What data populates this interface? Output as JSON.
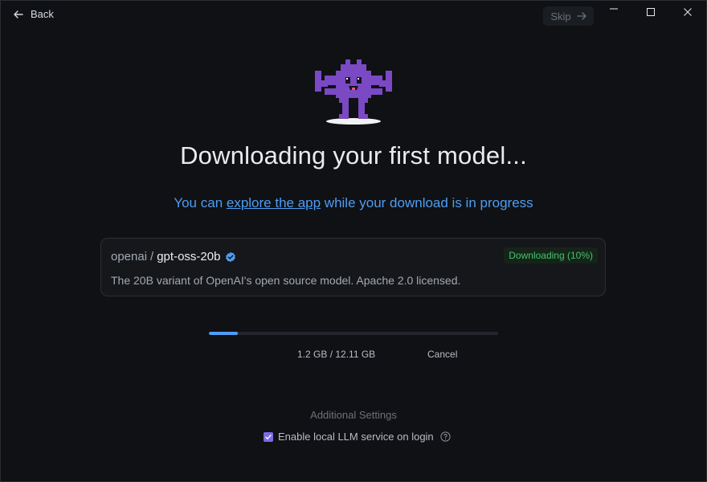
{
  "topbar": {
    "back_label": "Back",
    "skip_label": "Skip"
  },
  "main": {
    "title": "Downloading your first model...",
    "subtitle_prefix": "You can ",
    "subtitle_link": "explore the app",
    "subtitle_suffix": " while your download is in progress"
  },
  "model": {
    "org": "openai",
    "separator": "/",
    "name": "gpt-oss-20b",
    "description": "The 20B variant of OpenAI's open source model. Apache 2.0 licensed.",
    "status_badge": "Downloading (10%)"
  },
  "download": {
    "progress": 0.1,
    "size_text": "1.2 GB / 12.11 GB",
    "cancel_label": "Cancel"
  },
  "settings": {
    "heading": "Additional Settings",
    "option_label": "Enable local LLM service on login",
    "option_checked": true
  },
  "colors": {
    "accent_blue": "#4f9df2",
    "badge_green": "#45c46b",
    "mascot_purple": "#7b49c4",
    "checkbox_purple": "#7c6be6"
  },
  "icons": {
    "back": "arrow-left-icon",
    "skip": "arrow-right-icon",
    "verified": "verified-badge-icon",
    "help": "question-circle-icon",
    "checkbox": "check-icon"
  }
}
